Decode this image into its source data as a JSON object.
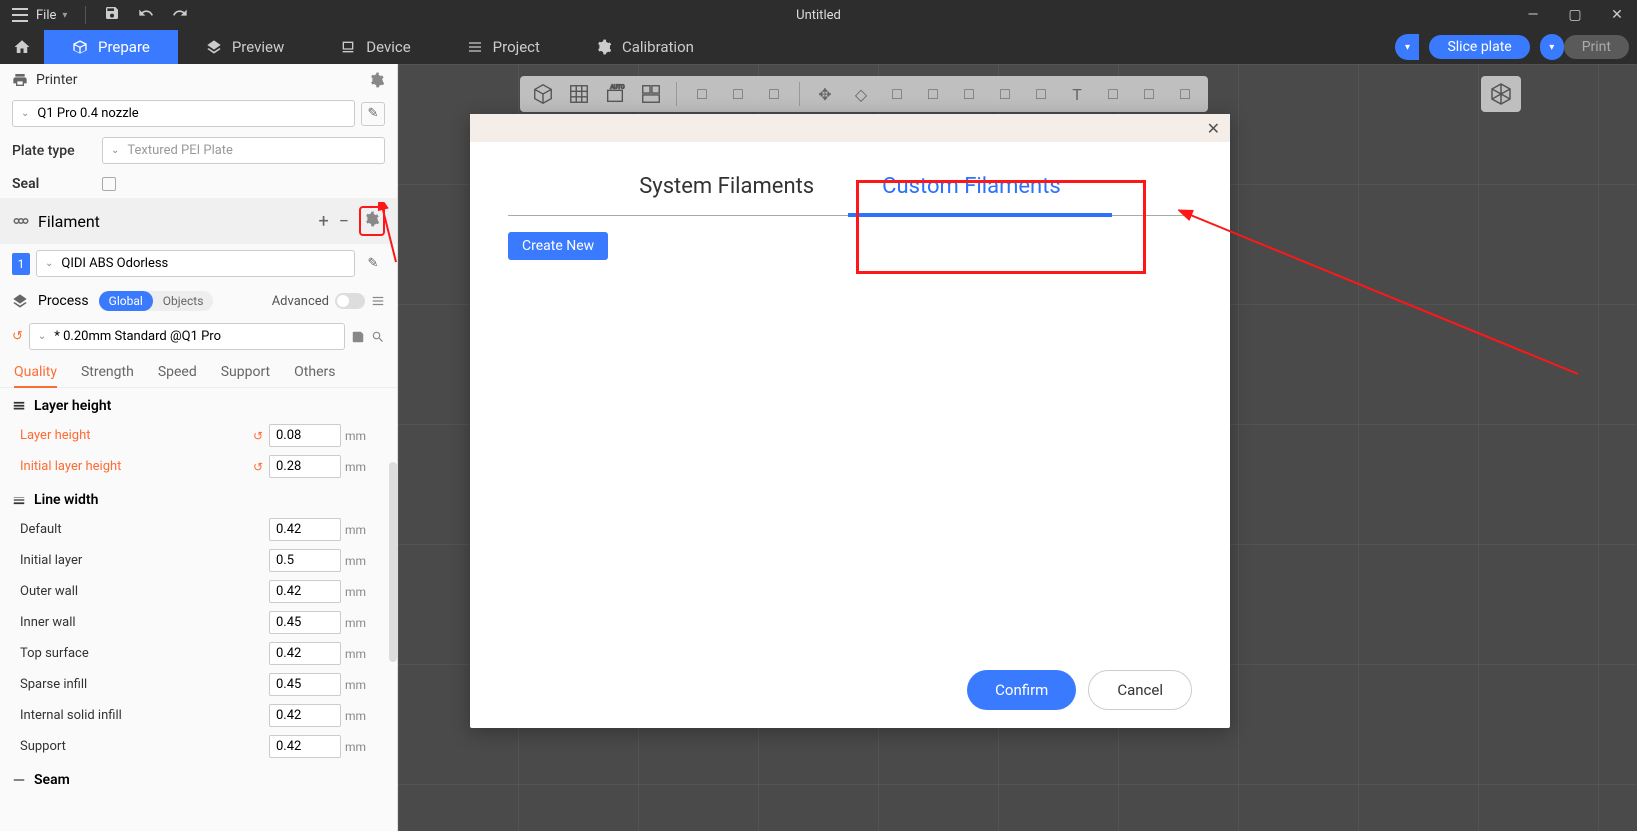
{
  "titlebar": {
    "file_menu": "File",
    "title": "Untitled"
  },
  "nav": {
    "prepare": "Prepare",
    "preview": "Preview",
    "device": "Device",
    "project": "Project",
    "calibration": "Calibration",
    "slice": "Slice plate",
    "print": "Print"
  },
  "sidebar": {
    "printer_label": "Printer",
    "printer_value": "Q1 Pro 0.4 nozzle",
    "plate_type_label": "Plate type",
    "plate_type_value": "Textured PEI Plate",
    "seal_label": "Seal",
    "filament_label": "Filament",
    "filament_num": "1",
    "filament_value": "QIDI ABS Odorless",
    "process_label": "Process",
    "global_label": "Global",
    "objects_label": "Objects",
    "advanced_label": "Advanced",
    "preset_value": "* 0.20mm Standard @Q1 Pro",
    "tabs": {
      "quality": "Quality",
      "strength": "Strength",
      "speed": "Speed",
      "support": "Support",
      "others": "Others"
    },
    "groups": {
      "layer_height": "Layer height",
      "line_width": "Line width",
      "seam": "Seam"
    },
    "params": [
      {
        "name": "Layer height",
        "value": "0.08",
        "unit": "mm",
        "changed": true
      },
      {
        "name": "Initial layer height",
        "value": "0.28",
        "unit": "mm",
        "changed": true
      },
      {
        "name": "Default",
        "value": "0.42",
        "unit": "mm",
        "changed": false
      },
      {
        "name": "Initial layer",
        "value": "0.5",
        "unit": "mm",
        "changed": false
      },
      {
        "name": "Outer wall",
        "value": "0.42",
        "unit": "mm",
        "changed": false
      },
      {
        "name": "Inner wall",
        "value": "0.45",
        "unit": "mm",
        "changed": false
      },
      {
        "name": "Top surface",
        "value": "0.42",
        "unit": "mm",
        "changed": false
      },
      {
        "name": "Sparse infill",
        "value": "0.45",
        "unit": "mm",
        "changed": false
      },
      {
        "name": "Internal solid infill",
        "value": "0.42",
        "unit": "mm",
        "changed": false
      },
      {
        "name": "Support",
        "value": "0.42",
        "unit": "mm",
        "changed": false
      }
    ]
  },
  "dialog": {
    "tab_system": "System Filaments",
    "tab_custom": "Custom Filaments",
    "create_new": "Create New",
    "confirm": "Confirm",
    "cancel": "Cancel"
  }
}
